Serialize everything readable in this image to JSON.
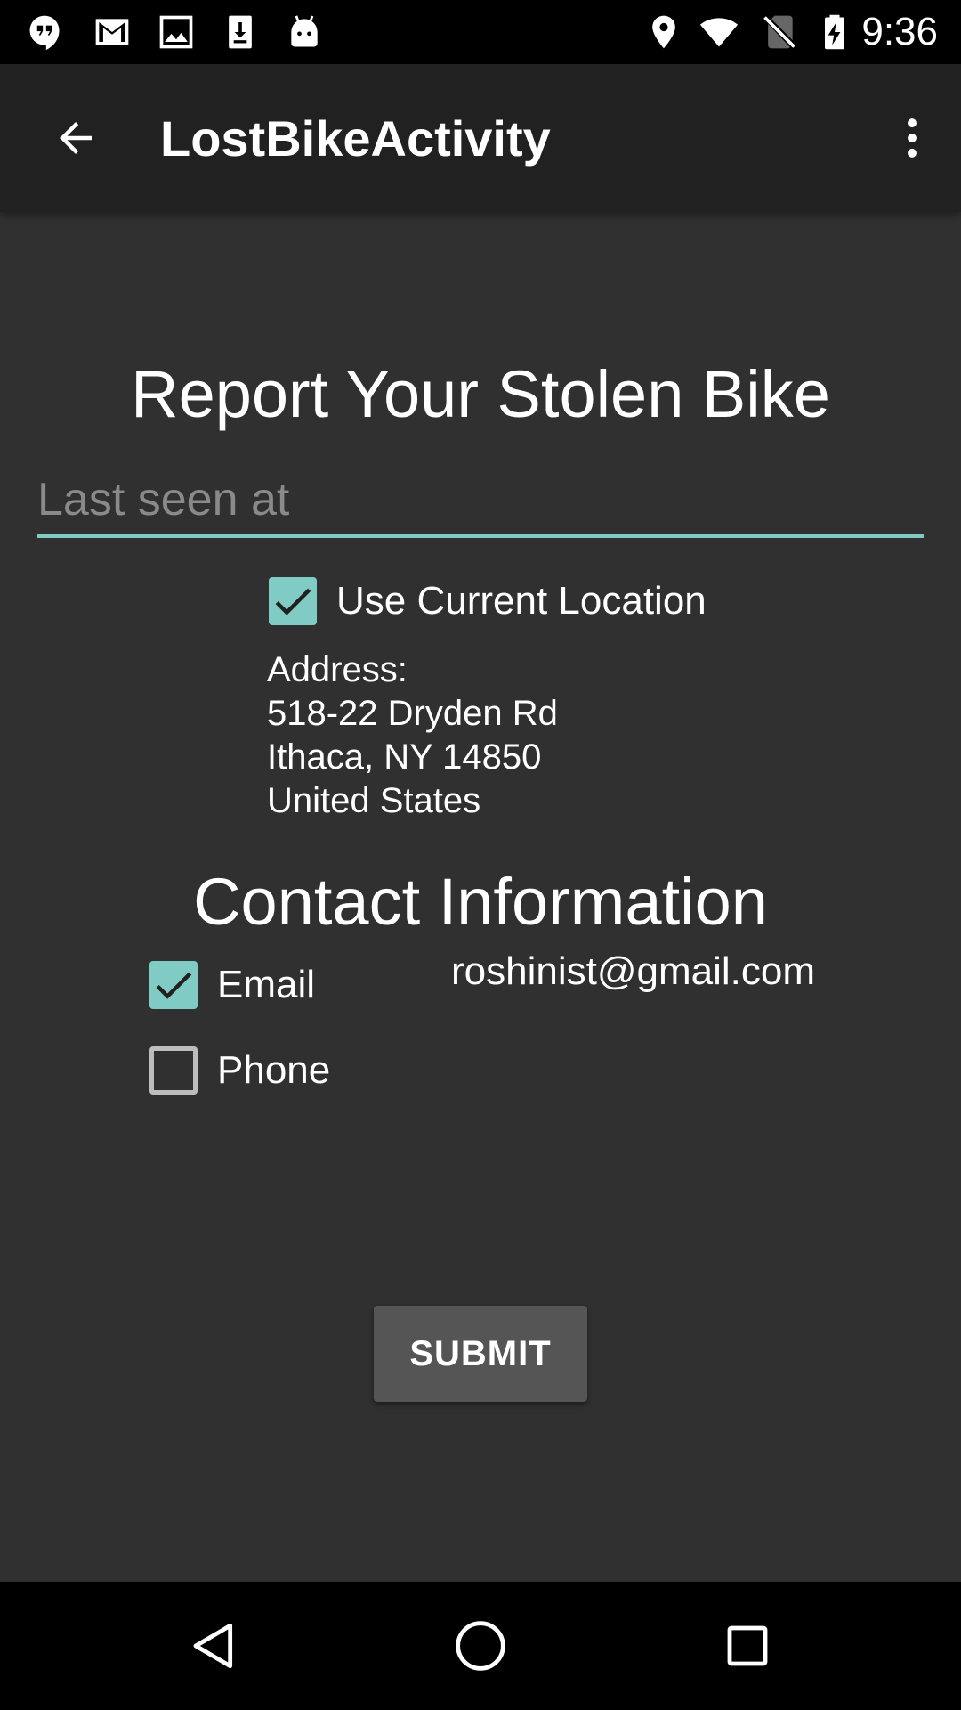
{
  "status_bar": {
    "time": "9:36",
    "left_icons": [
      "hangouts-icon",
      "gmail-icon",
      "image-icon",
      "download-icon",
      "android-icon"
    ],
    "right_icons": [
      "location-icon",
      "wifi-icon",
      "no-sim-icon",
      "battery-charging-icon"
    ]
  },
  "app_bar": {
    "title": "LostBikeActivity",
    "back_icon": "arrow-left-icon",
    "menu_icon": "more-vert-icon"
  },
  "report": {
    "heading": "Report Your Stolen Bike",
    "last_seen_placeholder": "Last seen at",
    "last_seen_value": "",
    "use_current_location_label": "Use Current Location",
    "use_current_location_checked": true,
    "address_label": "Address:",
    "address_lines": [
      "518-22 Dryden Rd",
      "Ithaca, NY 14850",
      "United States"
    ]
  },
  "contact": {
    "heading": "Contact Information",
    "email_label": "Email",
    "email_checked": true,
    "email_value": "roshinist@gmail.com",
    "phone_label": "Phone",
    "phone_checked": false
  },
  "submit_label": "SUBMIT",
  "colors": {
    "accent": "#80cbc4",
    "background": "#303030",
    "app_bar": "#212121",
    "button": "#555555"
  },
  "nav_bar": {
    "icons": [
      "back-triangle-icon",
      "home-circle-icon",
      "recents-square-icon"
    ]
  }
}
